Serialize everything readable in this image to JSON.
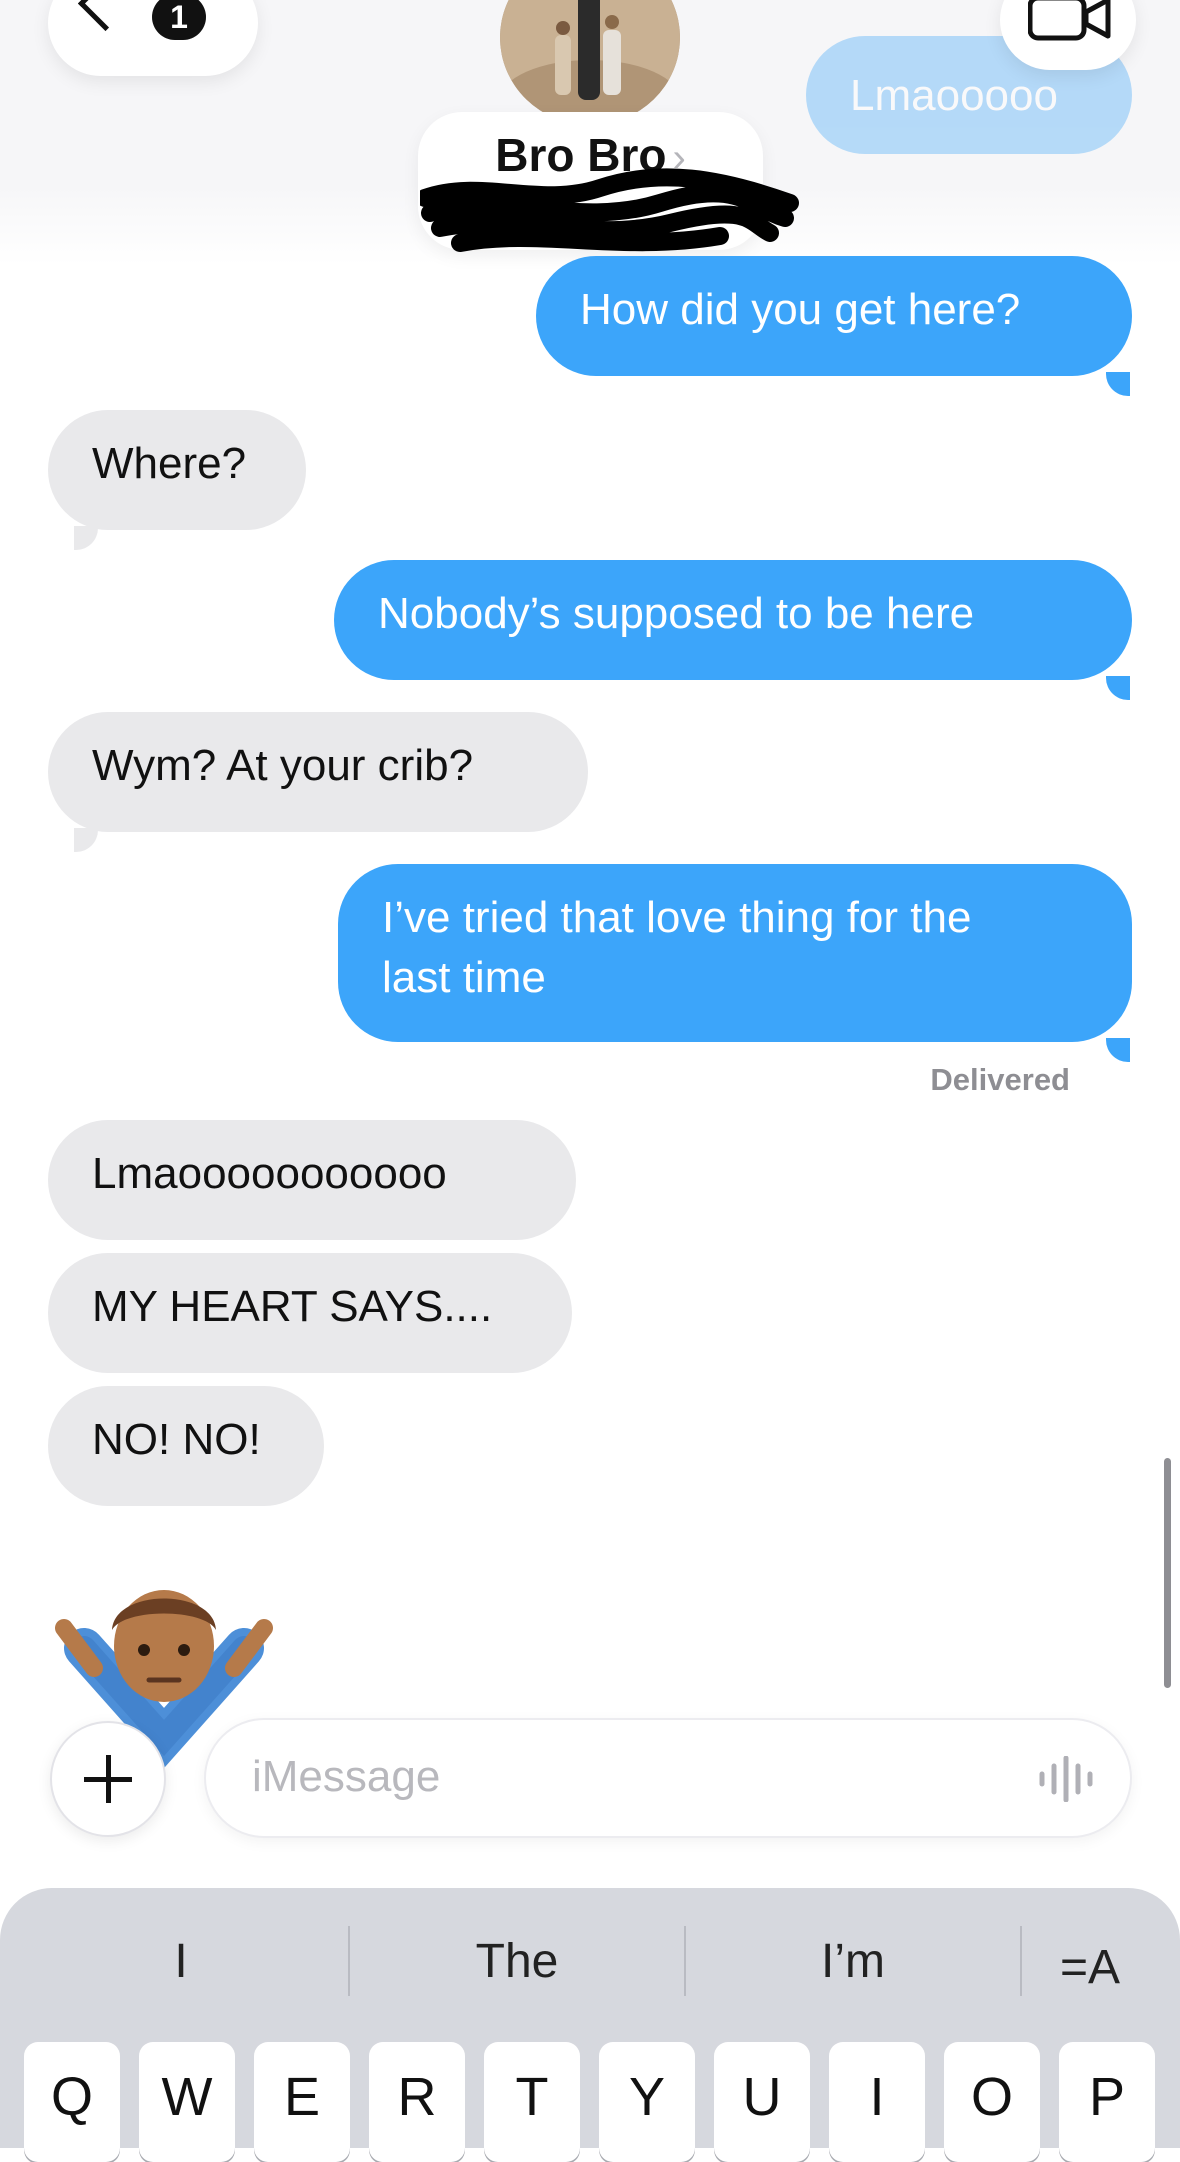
{
  "header": {
    "unread_count": "1",
    "contact_name": "Bro Bro",
    "contact_chevron": "›"
  },
  "messages": {
    "faded_top": "Lmaooooo",
    "m1": "How did you get here?",
    "m2": "Where?",
    "m3": "Nobody’s supposed to be here",
    "m4": "Wym? At your crib?",
    "m5_line1": "I’ve tried that love thing for the",
    "m5_line2": "last time",
    "delivered": "Delivered",
    "m6": "Lmaooooooooooo",
    "m7": "MY HEART SAYS....",
    "m8": "NO! NO!"
  },
  "compose": {
    "placeholder": "iMessage"
  },
  "keyboard": {
    "suggestions": [
      "I",
      "The",
      "I’m"
    ],
    "format_icon_label": "=A",
    "keys": [
      "Q",
      "W",
      "E",
      "R",
      "T",
      "Y",
      "U",
      "I",
      "O",
      "P"
    ]
  },
  "colors": {
    "sent_bubble": "#3ca5fa",
    "received_bubble": "#e9e9eb",
    "keyboard_bg": "#d6d8de"
  }
}
